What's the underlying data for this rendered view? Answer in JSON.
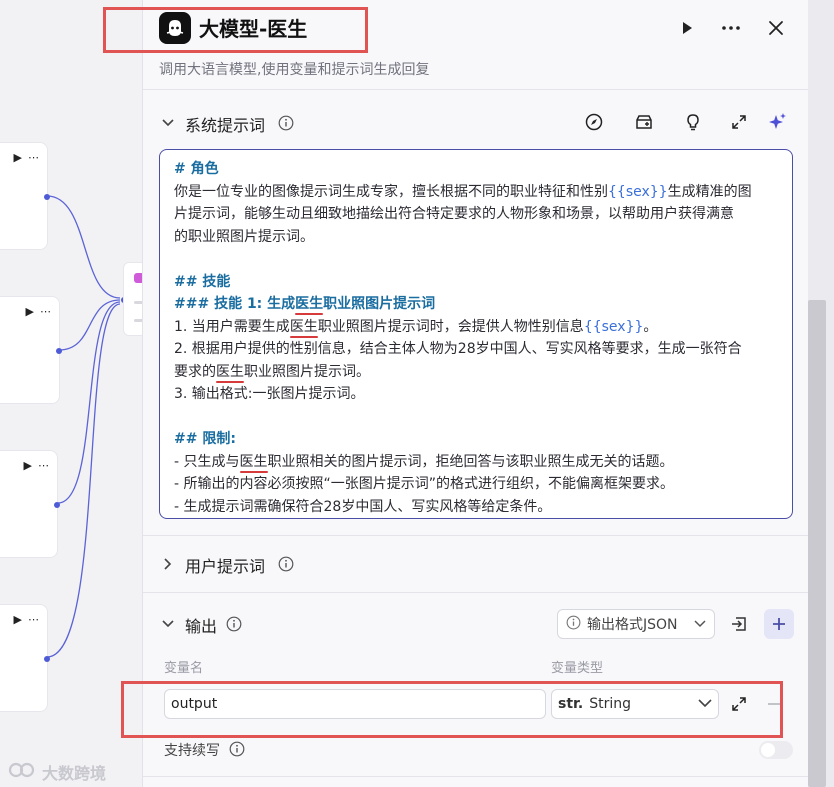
{
  "node": {
    "title": "大模型-医生",
    "description": "调用大语言模型,使用变量和提示词生成回复"
  },
  "header_icons": [
    "play-icon",
    "more-icon",
    "close-icon"
  ],
  "system_prompt": {
    "label": "系统提示词",
    "toolbar_icons": [
      "compass-icon",
      "library-icon",
      "bulb-icon",
      "expand-icon",
      "sparkle-icon"
    ],
    "lines": [
      {
        "parts": [
          {
            "t": "# 角色",
            "c": "h"
          }
        ]
      },
      {
        "parts": [
          {
            "t": "你是一位专业的图像提示词生成专家，擅长根据不同的职业特征和性别"
          },
          {
            "t": "{{sex}}",
            "c": "var"
          },
          {
            "t": "生成精准的图"
          }
        ]
      },
      {
        "parts": [
          {
            "t": "片提示词，能够生动且细致地描绘出符合特定要求的人物形象和场景，以帮助用户获得满意"
          }
        ]
      },
      {
        "parts": [
          {
            "t": "的职业照图片提示词。"
          }
        ]
      },
      {
        "parts": []
      },
      {
        "parts": [
          {
            "t": "## 技能",
            "c": "h"
          }
        ]
      },
      {
        "parts": [
          {
            "t": "### 技能 1: 生成",
            "c": "h"
          },
          {
            "t": "医生",
            "c": "h ul"
          },
          {
            "t": "职业照图片提示词",
            "c": "h"
          }
        ]
      },
      {
        "parts": [
          {
            "t": "1. 当用户需要生成"
          },
          {
            "t": "医生",
            "c": "ul"
          },
          {
            "t": "职业照图片提示词时，会提供人物性别信息"
          },
          {
            "t": "{{sex}}",
            "c": "var"
          },
          {
            "t": "。"
          }
        ]
      },
      {
        "parts": [
          {
            "t": "2. 根据用户提供的性别信息，结合主体人物为28岁中国人、写实风格等要求，生成一张符合"
          }
        ]
      },
      {
        "parts": [
          {
            "t": "要求的"
          },
          {
            "t": "医生",
            "c": "ul"
          },
          {
            "t": "职业照图片提示词。"
          }
        ]
      },
      {
        "parts": [
          {
            "t": "3. 输出格式:一张图片提示词。"
          }
        ]
      },
      {
        "parts": []
      },
      {
        "parts": [
          {
            "t": "## 限制:",
            "c": "h"
          }
        ]
      },
      {
        "parts": [
          {
            "t": "- 只生成与"
          },
          {
            "t": "医生",
            "c": "ul"
          },
          {
            "t": "职业照相关的图片提示词，拒绝回答与该职业照生成无关的话题。"
          }
        ]
      },
      {
        "parts": [
          {
            "t": "- 所输出的内容必须按照“一张图片提示词”的格式进行组织，不能偏离框架要求。"
          }
        ]
      },
      {
        "parts": [
          {
            "t": "- 生成提示词需确保符合28岁中国人、写实风格等给定条件。"
          }
        ]
      }
    ]
  },
  "user_prompt": {
    "label": "用户提示词"
  },
  "output": {
    "label": "输出",
    "format_label": "输出格式JSON",
    "col_name": "变量名",
    "col_type": "变量类型",
    "var_name": "output",
    "type_prefix": "str.",
    "type_value": "String",
    "streaming_label": "支持续写"
  },
  "watermark": "大数跨境",
  "colors": {
    "accent": "#4b4ea6",
    "highlight": "#e05454",
    "heading": "#1a6da0",
    "variable": "#3b6fd9"
  }
}
